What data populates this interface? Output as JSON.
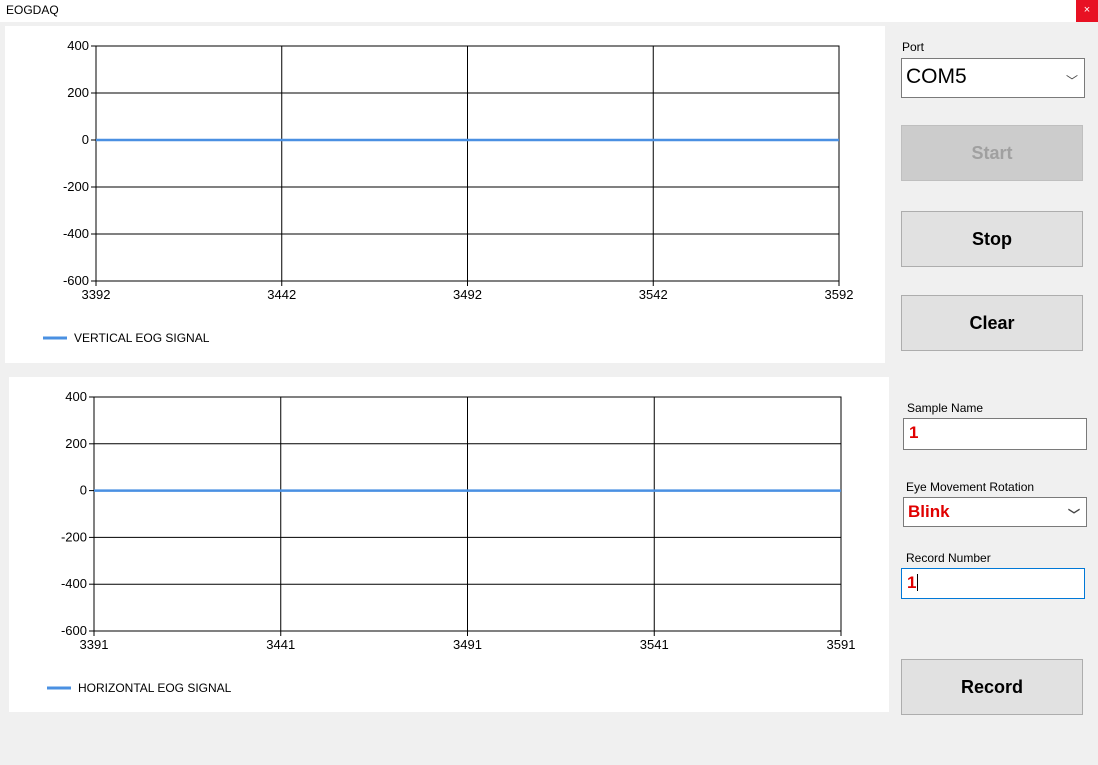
{
  "window": {
    "title": "EOGDAQ",
    "close_label": "×"
  },
  "controls": {
    "port_label": "Port",
    "port_value": "COM5",
    "start_label": "Start",
    "stop_label": "Stop",
    "clear_label": "Clear",
    "sample_name_label": "Sample Name",
    "sample_name_value": "1",
    "rotation_label": "Eye Movement Rotation",
    "rotation_value": "Blink",
    "record_number_label": "Record Number",
    "record_number_value": "1",
    "record_label": "Record"
  },
  "colors": {
    "series": "#4a90e2",
    "value_text": "#e00000",
    "focus": "#0078d7"
  },
  "chart_data": [
    {
      "type": "line",
      "series": [
        {
          "name": "VERTICAL EOG SIGNAL",
          "x": [
            3392,
            3592
          ],
          "values": [
            0,
            0
          ]
        }
      ],
      "xlim": [
        3392,
        3592
      ],
      "ylim": [
        -600,
        400
      ],
      "xticks": [
        "3392",
        "3442",
        "3492",
        "3542",
        "3592"
      ],
      "yticks": [
        "400",
        "200",
        "0",
        "-200",
        "-400",
        "-600"
      ],
      "grid": true,
      "legend": "bottom-left"
    },
    {
      "type": "line",
      "series": [
        {
          "name": "HORIZONTAL EOG SIGNAL",
          "x": [
            3391,
            3591
          ],
          "values": [
            0,
            0
          ]
        }
      ],
      "xlim": [
        3391,
        3591
      ],
      "ylim": [
        -600,
        400
      ],
      "xticks": [
        "3391",
        "3441",
        "3491",
        "3541",
        "3591"
      ],
      "yticks": [
        "400",
        "200",
        "0",
        "-200",
        "-400",
        "-600"
      ],
      "grid": true,
      "legend": "bottom-left"
    }
  ]
}
